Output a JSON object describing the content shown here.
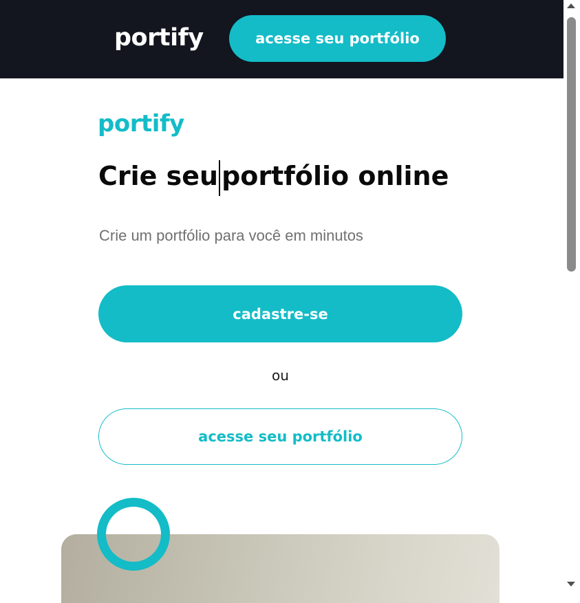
{
  "header": {
    "logo_text": "portify",
    "access_button_label": "acesse seu portfólio"
  },
  "hero": {
    "logo_text": "portify",
    "headline_before_caret": "Crie seu",
    "headline_after_caret": "portfólio online",
    "subtitle": "Crie um portfólio para você em minutos",
    "signup_button_label": "cadastre-se",
    "or_text": "ou",
    "access_button_label": "acesse seu portfólio"
  },
  "colors": {
    "brand": "#13bcc7",
    "header_background": "#13151f",
    "text_dark": "#0a0a0a",
    "text_muted": "#707070"
  },
  "icons": {
    "decorative_ring": "ring-shape",
    "scroll_up": "triangle-up",
    "scroll_down": "triangle-down"
  }
}
